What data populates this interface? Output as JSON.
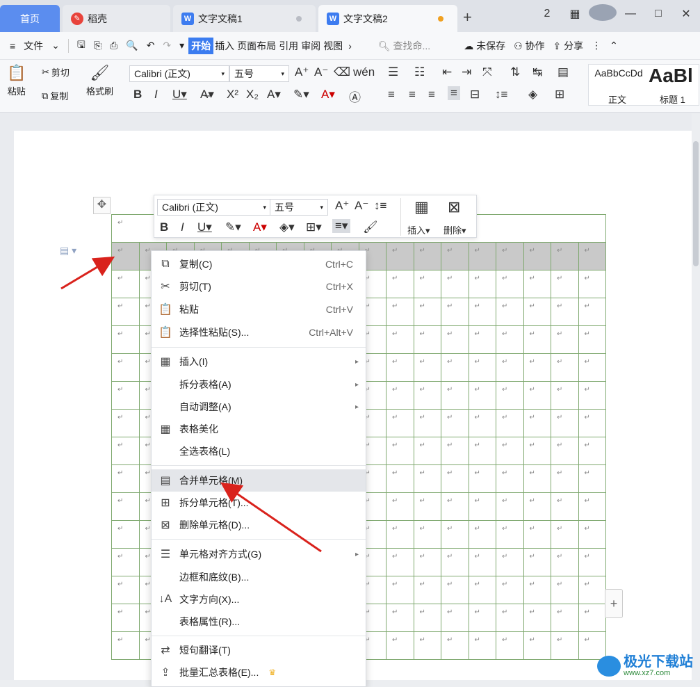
{
  "titlebar": {
    "home_tab": "首页",
    "tabs": [
      {
        "label": "稻壳",
        "icon": "docer-icon"
      },
      {
        "label": "文字文稿1",
        "icon": "wps-writer-icon"
      },
      {
        "label": "文字文稿2",
        "icon": "wps-writer-icon"
      }
    ],
    "new_tab": "+",
    "win_buttons": {
      "layout": "2",
      "grid": "▦",
      "minimize": "—",
      "maximize": "□",
      "close": "✕"
    }
  },
  "menubar": {
    "menu_icon": "≡",
    "file": "文件",
    "tabs": [
      "开始",
      "插入",
      "页面布局",
      "引用",
      "审阅",
      "视图"
    ],
    "more": "›",
    "search_placeholder": "查找命...",
    "unsaved": "未保存",
    "collaborate": "协作",
    "share": "分享"
  },
  "ribbon": {
    "paste": "粘贴",
    "cut": "剪切",
    "copy": "复制",
    "format_painter": "格式刷",
    "font_name": "Calibri (正文)",
    "font_size": "五号",
    "styles": {
      "normal_preview": "AaBbCcDd",
      "normal_label": "正文",
      "heading_preview": "AaBl",
      "heading_label": "标题 1"
    }
  },
  "mini_toolbar": {
    "font_name": "Calibri (正文)",
    "font_size": "五号",
    "insert": "插入",
    "delete": "删除"
  },
  "table": {
    "rows": 16,
    "cols": 18,
    "cell_mark": "↵",
    "selected_row": 1,
    "border_color": "#7ea86e"
  },
  "context_menu": {
    "items": [
      {
        "label": "复制(C)",
        "shortcut": "Ctrl+C",
        "icon": "copy-icon"
      },
      {
        "label": "剪切(T)",
        "shortcut": "Ctrl+X",
        "icon": "scissors-icon"
      },
      {
        "label": "粘贴",
        "shortcut": "Ctrl+V",
        "icon": "paste-icon"
      },
      {
        "label": "选择性粘贴(S)...",
        "shortcut": "Ctrl+Alt+V",
        "icon": "paste-special-icon"
      },
      {
        "label": "插入(I)",
        "icon": "table-insert-icon"
      },
      {
        "label": "拆分表格(A)"
      },
      {
        "label": "自动调整(A)"
      },
      {
        "label": "表格美化",
        "icon": "table-beautify-icon"
      },
      {
        "label": "全选表格(L)"
      },
      {
        "label": "合并单元格(M)",
        "icon": "merge-cells-icon"
      },
      {
        "label": "拆分单元格(T)...",
        "icon": "split-cells-icon"
      },
      {
        "label": "删除单元格(D)...",
        "icon": "delete-cells-icon"
      },
      {
        "label": "单元格对齐方式(G)",
        "icon": "cell-align-icon"
      },
      {
        "label": "边框和底纹(B)..."
      },
      {
        "label": "文字方向(X)...",
        "icon": "text-direction-icon"
      },
      {
        "label": "表格属性(R)..."
      },
      {
        "label": "短句翻译(T)",
        "icon": "translate-icon"
      },
      {
        "label": "批量汇总表格(E)...",
        "icon": "batch-summary-icon"
      }
    ]
  },
  "watermark": {
    "name": "极光下载站",
    "url": "www.xz7.com"
  },
  "accent_color": "#3b7cf0",
  "arrow_color": "#d9221c"
}
